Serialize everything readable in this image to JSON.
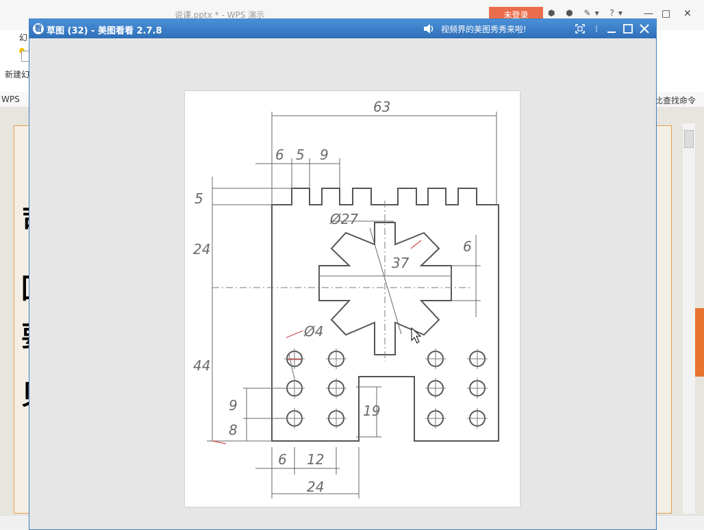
{
  "wps": {
    "title": "说课.pptx * - WPS 演示",
    "login_label": "未登录",
    "icon_strip": "⬢ ⬢ ✎▾ ?▾",
    "tab_fragment": "幻",
    "new_slide_label": "新建幻",
    "strip_left": "WPS",
    "strip_right": "比查找命令",
    "slide_chars": [
      "司",
      "回",
      "要",
      "贝"
    ],
    "minimize": "—",
    "maximize": "□",
    "close": "✕"
  },
  "viewer": {
    "title": "草图 (32) - 美图看看 2.7.8",
    "logo_glyph": "看",
    "promo_text": "视频界的美图秀秀来啦!",
    "drawing_dims": {
      "d63": "63",
      "d6_top": "6",
      "d5_top": "5",
      "d9_top": "9",
      "d5_left": "5",
      "d24_left": "24",
      "d44_left": "44",
      "d9_left": "9",
      "d8_left": "8",
      "dphi27": "Ø27",
      "d37": "37",
      "d6_right": "6",
      "dphi4": "Ø4",
      "d19": "19",
      "d6_bottom": "6",
      "d12_bottom": "12",
      "d24_bottom": "24"
    }
  }
}
